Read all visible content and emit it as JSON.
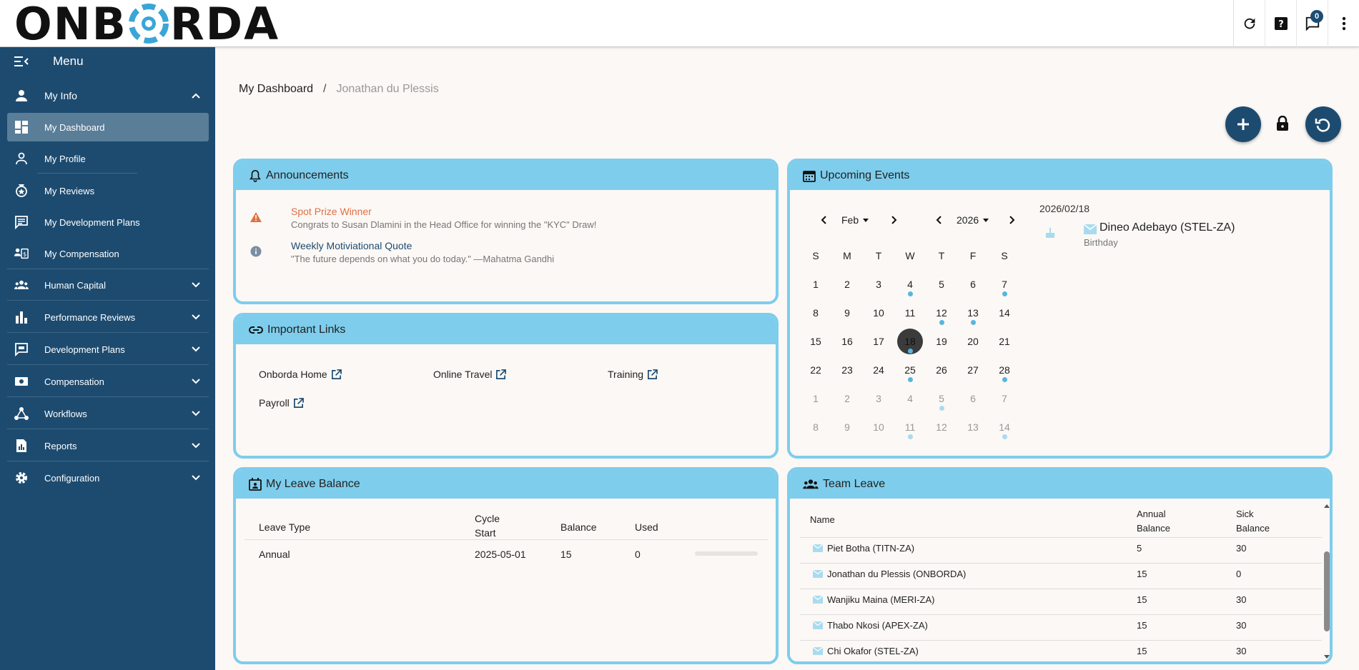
{
  "brand": {
    "name_left": "ONB",
    "name_right": "RDA"
  },
  "topbar": {
    "notifications_count": "0"
  },
  "sidebar": {
    "menu_label": "Menu",
    "items": [
      {
        "label": "My Info"
      },
      {
        "label": "My Dashboard"
      },
      {
        "label": "My Profile"
      },
      {
        "label": "My Reviews"
      },
      {
        "label": "My Development Plans"
      },
      {
        "label": "My Compensation"
      },
      {
        "label": "Human Capital"
      },
      {
        "label": "Performance Reviews"
      },
      {
        "label": "Development Plans"
      },
      {
        "label": "Compensation"
      },
      {
        "label": "Workflows"
      },
      {
        "label": "Reports"
      },
      {
        "label": "Configuration"
      }
    ]
  },
  "breadcrumb": {
    "root": "My Dashboard",
    "sep": "/",
    "current": "Jonathan du Plessis"
  },
  "announcements": {
    "title": "Announcements",
    "items": [
      {
        "title": "Spot Prize Winner",
        "desc": "Congrats to Susan Dlamini in the Head Office for winning the \"KYC\" Draw!"
      },
      {
        "title": "Weekly Motiviational Quote",
        "desc": "\"The future depends on what you do today.\" —Mahatma Gandhi"
      }
    ]
  },
  "links": {
    "title": "Important Links",
    "items": [
      "Onborda Home",
      "Online Travel",
      "Training",
      "Payroll"
    ]
  },
  "events": {
    "title": "Upcoming Events",
    "month": "Feb",
    "year": "2026",
    "weekdays": [
      "S",
      "M",
      "T",
      "W",
      "T",
      "F",
      "S"
    ],
    "days": [
      [
        "1",
        "2",
        "3",
        "4",
        "5",
        "6",
        "7"
      ],
      [
        "8",
        "9",
        "10",
        "11",
        "12",
        "13",
        "14"
      ],
      [
        "15",
        "16",
        "17",
        "18",
        "19",
        "20",
        "21"
      ],
      [
        "22",
        "23",
        "24",
        "25",
        "26",
        "27",
        "28"
      ],
      [
        "1",
        "2",
        "3",
        "4",
        "5",
        "6",
        "7"
      ],
      [
        "8",
        "9",
        "10",
        "11",
        "12",
        "13",
        "14"
      ]
    ],
    "selected_date": "2026/02/18",
    "event_name": "Dineo Adebayo (STEL-ZA)",
    "event_type": "Birthday"
  },
  "leave": {
    "title": "My Leave Balance",
    "headers": {
      "type": "Leave Type",
      "cycle1": "Cycle",
      "cycle2": "Start",
      "balance": "Balance",
      "used": "Used"
    },
    "rows": [
      {
        "type": "Annual",
        "start": "2025-05-01",
        "balance": "15",
        "used": "0"
      }
    ]
  },
  "team": {
    "title": "Team Leave",
    "headers": {
      "name": "Name",
      "annual1": "Annual",
      "annual2": "Balance",
      "sick1": "Sick",
      "sick2": "Balance"
    },
    "rows": [
      {
        "name": "Piet Botha (TITN-ZA)",
        "annual": "5",
        "sick": "30"
      },
      {
        "name": "Jonathan du Plessis (ONBORDA)",
        "annual": "15",
        "sick": "0"
      },
      {
        "name": "Wanjiku Maina (MERI-ZA)",
        "annual": "15",
        "sick": "30"
      },
      {
        "name": "Thabo Nkosi (APEX-ZA)",
        "annual": "15",
        "sick": "30"
      },
      {
        "name": "Chi Okafor (STEL-ZA)",
        "annual": "15",
        "sick": "30"
      }
    ]
  }
}
